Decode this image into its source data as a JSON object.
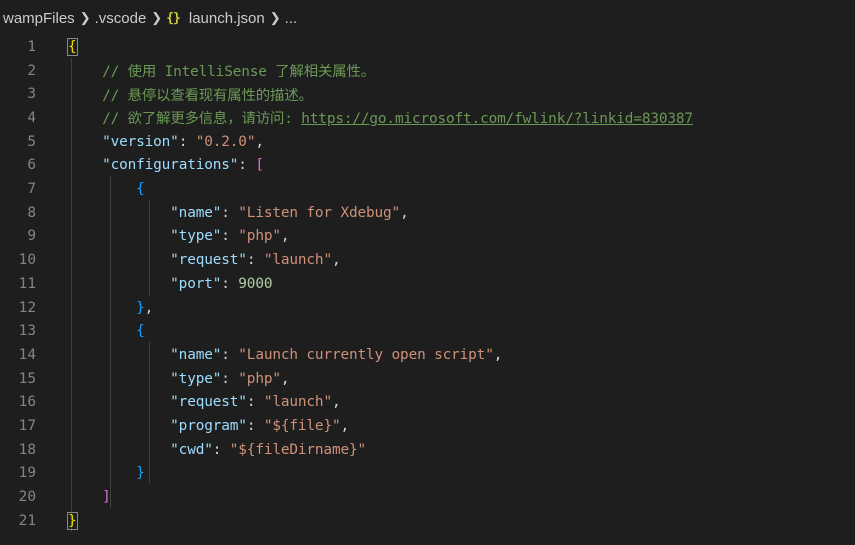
{
  "breadcrumb": {
    "items": [
      {
        "label": "wampFiles",
        "icon": "folder"
      },
      {
        "label": ".vscode",
        "icon": "folder"
      },
      {
        "label": "launch.json",
        "icon": "json-braces-icon"
      },
      {
        "label": "..."
      }
    ],
    "json_icon_glyph": "{}"
  },
  "colors": {
    "background": "#1e1e1e",
    "line_number": "#858585",
    "key": "#9cdcfe",
    "string": "#ce9178",
    "number": "#b5cea8",
    "comment": "#6a9955",
    "bracket_level1": "#ffd700",
    "bracket_level2": "#da70d6",
    "bracket_level3": "#179fff"
  },
  "code": {
    "line_numbers": [
      "1",
      "2",
      "3",
      "4",
      "5",
      "6",
      "7",
      "8",
      "9",
      "10",
      "11",
      "12",
      "13",
      "14",
      "15",
      "16",
      "17",
      "18",
      "19",
      "20",
      "21"
    ],
    "lines": [
      [
        {
          "t": "{",
          "c": "b1 bmatch"
        }
      ],
      [
        {
          "t": "    "
        },
        {
          "t": "// 使用 IntelliSense 了解相关属性。",
          "c": "c"
        }
      ],
      [
        {
          "t": "    "
        },
        {
          "t": "// 悬停以查看现有属性的描述。",
          "c": "c"
        }
      ],
      [
        {
          "t": "    "
        },
        {
          "t": "// 欲了解更多信息，请访问: ",
          "c": "c"
        },
        {
          "t": "https://go.microsoft.com/fwlink/?linkid=830387",
          "c": "url",
          "name": "link-url"
        }
      ],
      [
        {
          "t": "    "
        },
        {
          "t": "\"version\"",
          "c": "k"
        },
        {
          "t": ": ",
          "c": "p"
        },
        {
          "t": "\"0.2.0\"",
          "c": "s"
        },
        {
          "t": ",",
          "c": "p"
        }
      ],
      [
        {
          "t": "    "
        },
        {
          "t": "\"configurations\"",
          "c": "k"
        },
        {
          "t": ": ",
          "c": "p"
        },
        {
          "t": "[",
          "c": "b2"
        }
      ],
      [
        {
          "t": "        "
        },
        {
          "t": "{",
          "c": "b3"
        }
      ],
      [
        {
          "t": "            "
        },
        {
          "t": "\"name\"",
          "c": "k"
        },
        {
          "t": ": ",
          "c": "p"
        },
        {
          "t": "\"Listen for Xdebug\"",
          "c": "s"
        },
        {
          "t": ",",
          "c": "p"
        }
      ],
      [
        {
          "t": "            "
        },
        {
          "t": "\"type\"",
          "c": "k"
        },
        {
          "t": ": ",
          "c": "p"
        },
        {
          "t": "\"php\"",
          "c": "s"
        },
        {
          "t": ",",
          "c": "p"
        }
      ],
      [
        {
          "t": "            "
        },
        {
          "t": "\"request\"",
          "c": "k"
        },
        {
          "t": ": ",
          "c": "p"
        },
        {
          "t": "\"launch\"",
          "c": "s"
        },
        {
          "t": ",",
          "c": "p"
        }
      ],
      [
        {
          "t": "            "
        },
        {
          "t": "\"port\"",
          "c": "k"
        },
        {
          "t": ": ",
          "c": "p"
        },
        {
          "t": "9000",
          "c": "n"
        }
      ],
      [
        {
          "t": "        "
        },
        {
          "t": "}",
          "c": "b3"
        },
        {
          "t": ",",
          "c": "p"
        }
      ],
      [
        {
          "t": "        "
        },
        {
          "t": "{",
          "c": "b3"
        }
      ],
      [
        {
          "t": "            "
        },
        {
          "t": "\"name\"",
          "c": "k"
        },
        {
          "t": ": ",
          "c": "p"
        },
        {
          "t": "\"Launch currently open script\"",
          "c": "s"
        },
        {
          "t": ",",
          "c": "p"
        }
      ],
      [
        {
          "t": "            "
        },
        {
          "t": "\"type\"",
          "c": "k"
        },
        {
          "t": ": ",
          "c": "p"
        },
        {
          "t": "\"php\"",
          "c": "s"
        },
        {
          "t": ",",
          "c": "p"
        }
      ],
      [
        {
          "t": "            "
        },
        {
          "t": "\"request\"",
          "c": "k"
        },
        {
          "t": ": ",
          "c": "p"
        },
        {
          "t": "\"launch\"",
          "c": "s"
        },
        {
          "t": ",",
          "c": "p"
        }
      ],
      [
        {
          "t": "            "
        },
        {
          "t": "\"program\"",
          "c": "k"
        },
        {
          "t": ": ",
          "c": "p"
        },
        {
          "t": "\"${file}\"",
          "c": "s"
        },
        {
          "t": ",",
          "c": "p"
        }
      ],
      [
        {
          "t": "            "
        },
        {
          "t": "\"cwd\"",
          "c": "k"
        },
        {
          "t": ": ",
          "c": "p"
        },
        {
          "t": "\"${fileDirname}\"",
          "c": "s"
        }
      ],
      [
        {
          "t": "        "
        },
        {
          "t": "}",
          "c": "b3"
        }
      ],
      [
        {
          "t": "    "
        },
        {
          "t": "]",
          "c": "b2"
        }
      ],
      [
        {
          "t": "}",
          "c": "b1 bmatch"
        }
      ]
    ]
  }
}
